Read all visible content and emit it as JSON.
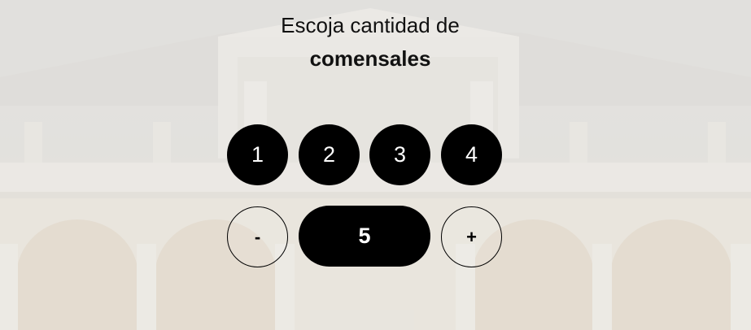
{
  "heading": {
    "line1": "Escoja cantidad de",
    "line2": "comensales"
  },
  "quick_options": [
    "1",
    "2",
    "3",
    "4"
  ],
  "stepper": {
    "decrement_label": "-",
    "value": "5",
    "increment_label": "+"
  },
  "colors": {
    "button_fill": "#000000",
    "button_text": "#ffffff"
  }
}
